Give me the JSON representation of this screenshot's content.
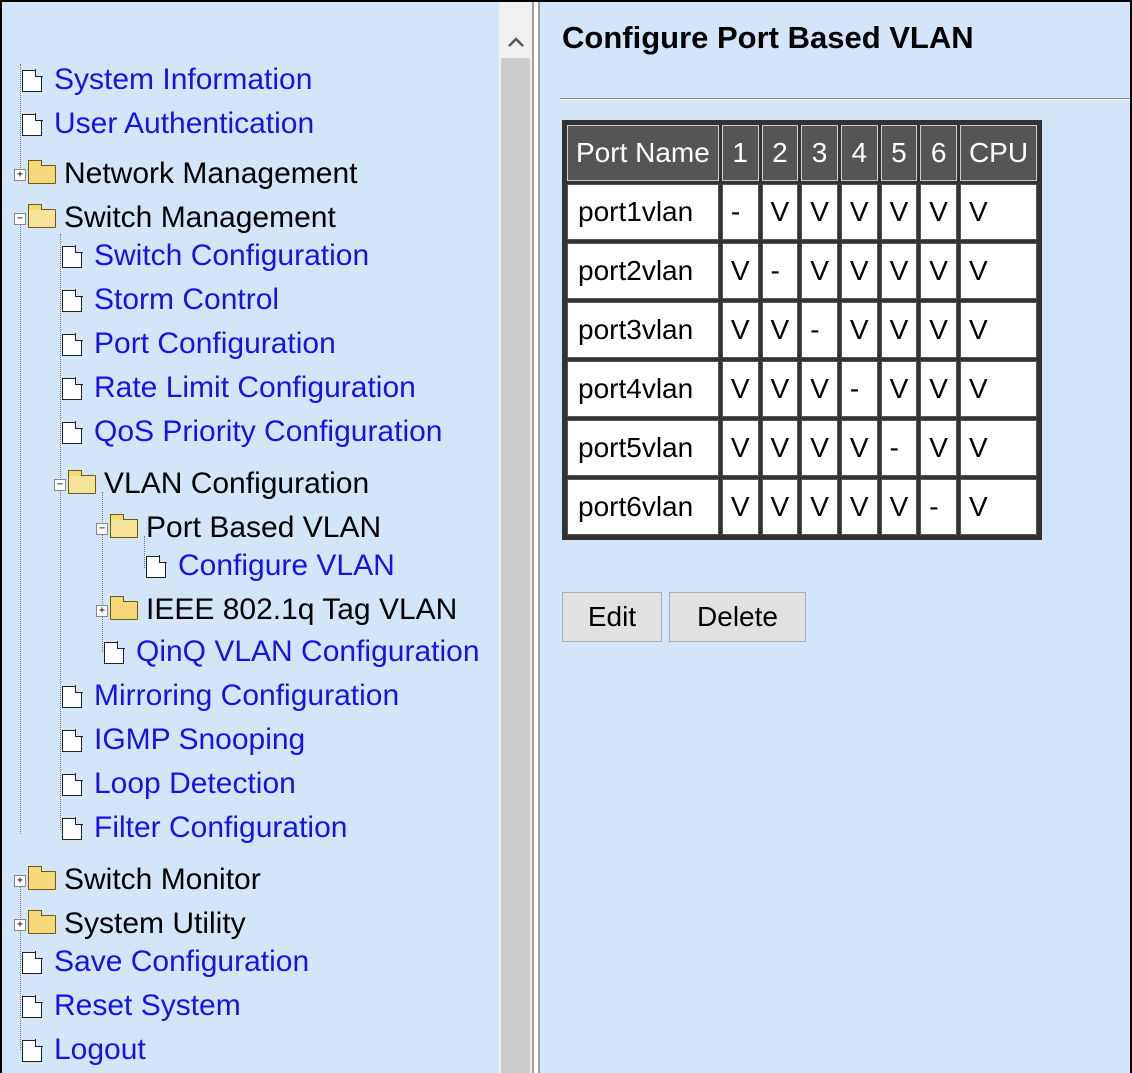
{
  "tree": {
    "items": [
      {
        "label": "System Information",
        "type": "doc",
        "link": true
      },
      {
        "label": "User Authentication",
        "type": "doc",
        "link": true
      },
      {
        "label": "Network Management",
        "type": "folder",
        "link": false,
        "expanded": false
      },
      {
        "label": "Switch Management",
        "type": "folder",
        "link": false,
        "expanded": true
      },
      {
        "label": "Switch Configuration",
        "type": "doc",
        "link": true
      },
      {
        "label": "Storm Control",
        "type": "doc",
        "link": true
      },
      {
        "label": "Port Configuration",
        "type": "doc",
        "link": true
      },
      {
        "label": "Rate Limit Configuration",
        "type": "doc",
        "link": true
      },
      {
        "label": "QoS Priority Configuration",
        "type": "doc",
        "link": true
      },
      {
        "label": "VLAN Configuration",
        "type": "folder",
        "link": false,
        "expanded": true
      },
      {
        "label": "Port Based VLAN",
        "type": "folder",
        "link": false,
        "expanded": true
      },
      {
        "label": "Configure VLAN",
        "type": "doc",
        "link": true
      },
      {
        "label": "IEEE 802.1q Tag VLAN",
        "type": "folder",
        "link": false,
        "expanded": false
      },
      {
        "label": "QinQ VLAN Configuration",
        "type": "doc",
        "link": true
      },
      {
        "label": "Mirroring Configuration",
        "type": "doc",
        "link": true
      },
      {
        "label": "IGMP Snooping",
        "type": "doc",
        "link": true
      },
      {
        "label": "Loop Detection",
        "type": "doc",
        "link": true
      },
      {
        "label": "Filter Configuration",
        "type": "doc",
        "link": true
      },
      {
        "label": "Switch Monitor",
        "type": "folder",
        "link": false,
        "expanded": false
      },
      {
        "label": "System Utility",
        "type": "folder",
        "link": false,
        "expanded": false
      },
      {
        "label": "Save Configuration",
        "type": "doc",
        "link": true
      },
      {
        "label": "Reset System",
        "type": "doc",
        "link": true
      },
      {
        "label": "Logout",
        "type": "doc",
        "link": true
      }
    ]
  },
  "page": {
    "title": "Configure Port Based VLAN"
  },
  "vlan_table": {
    "headers": [
      "Port Name",
      "1",
      "2",
      "3",
      "4",
      "5",
      "6",
      "CPU"
    ],
    "rows": [
      [
        "port1vlan",
        "-",
        "V",
        "V",
        "V",
        "V",
        "V",
        "V"
      ],
      [
        "port2vlan",
        "V",
        "-",
        "V",
        "V",
        "V",
        "V",
        "V"
      ],
      [
        "port3vlan",
        "V",
        "V",
        "-",
        "V",
        "V",
        "V",
        "V"
      ],
      [
        "port4vlan",
        "V",
        "V",
        "V",
        "-",
        "V",
        "V",
        "V"
      ],
      [
        "port5vlan",
        "V",
        "V",
        "V",
        "V",
        "-",
        "V",
        "V"
      ],
      [
        "port6vlan",
        "V",
        "V",
        "V",
        "V",
        "V",
        "-",
        "V"
      ]
    ]
  },
  "buttons": {
    "edit": "Edit",
    "delete": "Delete"
  },
  "colors": {
    "panel_bg": "#d3e6f9",
    "link": "#1414e6",
    "header_bg": "#555555"
  }
}
